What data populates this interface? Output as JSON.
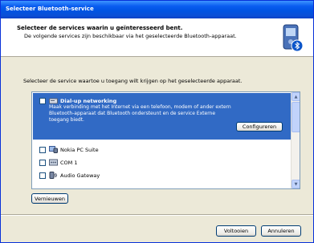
{
  "window": {
    "title": "Selecteer Bluetooth-service"
  },
  "header": {
    "title": "Selecteer de services waarin u geïnteresseerd bent.",
    "subtitle": "De volgende services zijn beschikbaar via het geselecteerde Bluetooth-apparaat.",
    "icon": "bluetooth-device-icon"
  },
  "instruction": "Selecteer de service waartoe u toegang wilt krijgen op het geselecteerde apparaat.",
  "services": [
    {
      "name": "Dial-up networking",
      "checked": false,
      "selected": true,
      "description": "Maak verbinding met het Internet via een telefoon, modem of ander extern Bluetooth-apparaat dat Bluetooth ondersteunt en de service Externe toegang biedt.",
      "button": "Configureren",
      "icon": "modem-icon"
    },
    {
      "name": "Nokia PC Suite",
      "checked": false,
      "selected": false,
      "icon": "pc-suite-icon"
    },
    {
      "name": "COM 1",
      "checked": false,
      "selected": false,
      "icon": "serial-port-icon"
    },
    {
      "name": "Audio Gateway",
      "checked": false,
      "selected": false,
      "icon": "audio-gateway-icon"
    }
  ],
  "buttons": {
    "refresh": "Vernieuwen",
    "finish": "Voltooien",
    "cancel": "Annuleren"
  },
  "colors": {
    "titlebar": "#0054E3",
    "selection": "#316AC5",
    "face": "#ECE9D8"
  }
}
